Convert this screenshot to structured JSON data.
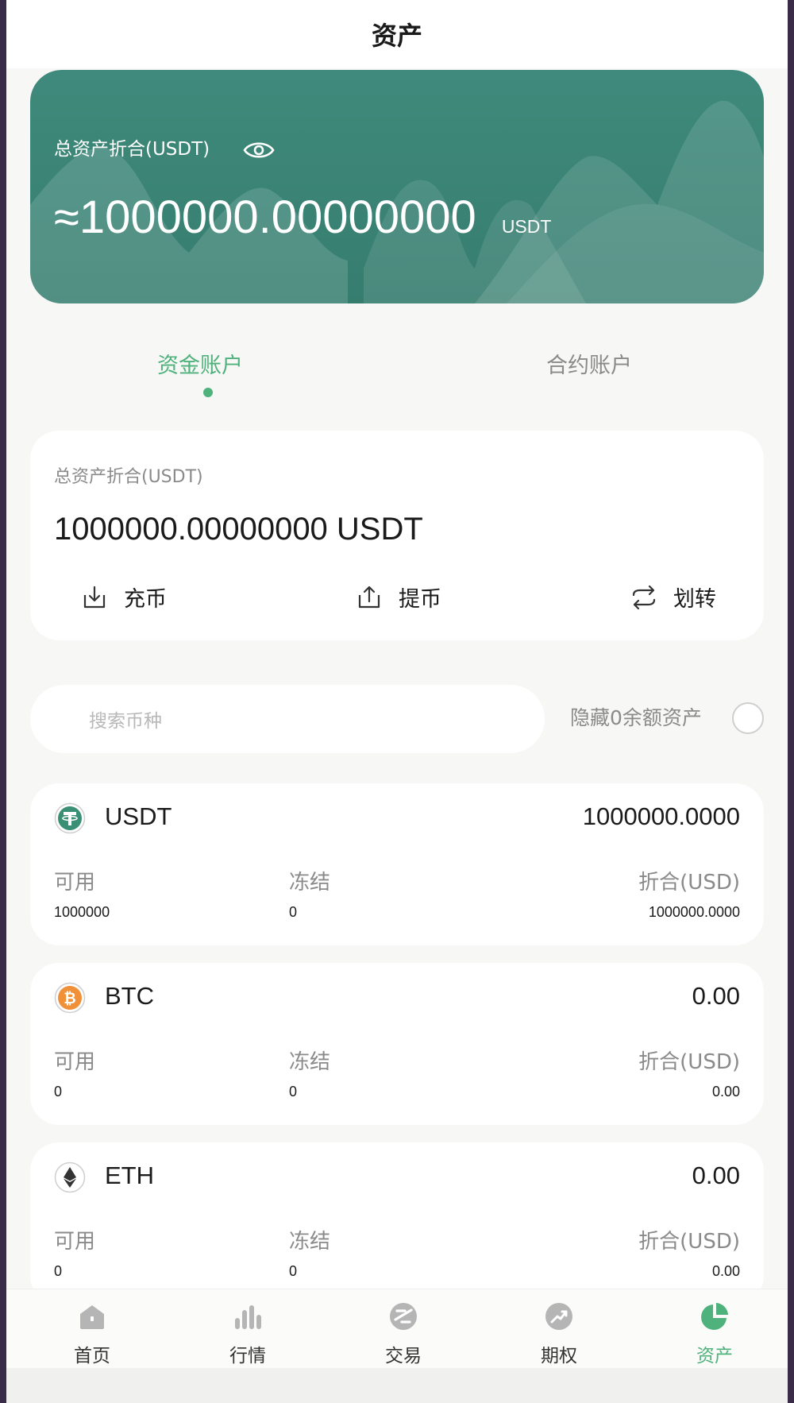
{
  "header": {
    "title": "资产"
  },
  "banner": {
    "label": "总资产折合(USDT)",
    "amount": "≈1000000.00000000",
    "unit": "USDT"
  },
  "tabs": [
    {
      "label": "资金账户",
      "active": true
    },
    {
      "label": "合约账户",
      "active": false
    }
  ],
  "account": {
    "label": "总资产折合(USDT)",
    "amount": "1000000.00000000 USDT",
    "actions": [
      {
        "label": "充币",
        "icon": "download-icon"
      },
      {
        "label": "提币",
        "icon": "upload-icon"
      },
      {
        "label": "划转",
        "icon": "transfer-icon"
      }
    ]
  },
  "search": {
    "placeholder": "搜索币种",
    "hide_zero_label": "隐藏0余额资产"
  },
  "columns": {
    "available": "可用",
    "frozen": "冻结",
    "converted": "折合(USD)"
  },
  "coins": [
    {
      "name": "USDT",
      "total": "1000000.0000",
      "available": "1000000",
      "frozen": "0",
      "converted": "1000000.0000",
      "icon": "usdt-logo-icon",
      "color": "#3a8f74"
    },
    {
      "name": "BTC",
      "total": "0.00",
      "available": "0",
      "frozen": "0",
      "converted": "0.00",
      "icon": "btc-logo-icon",
      "color": "#f0913a"
    },
    {
      "name": "ETH",
      "total": "0.00",
      "available": "0",
      "frozen": "0",
      "converted": "0.00",
      "icon": "eth-logo-icon",
      "color": "#333333"
    }
  ],
  "tabbar": [
    {
      "label": "首页",
      "icon": "home-icon",
      "active": false
    },
    {
      "label": "行情",
      "icon": "bar-chart-icon",
      "active": false
    },
    {
      "label": "交易",
      "icon": "trade-icon",
      "active": false
    },
    {
      "label": "期权",
      "icon": "trend-up-icon",
      "active": false
    },
    {
      "label": "资产",
      "icon": "pie-chart-icon",
      "active": true
    }
  ],
  "colors": {
    "accent": "#4fb27c",
    "banner": "#3f8a7c"
  }
}
